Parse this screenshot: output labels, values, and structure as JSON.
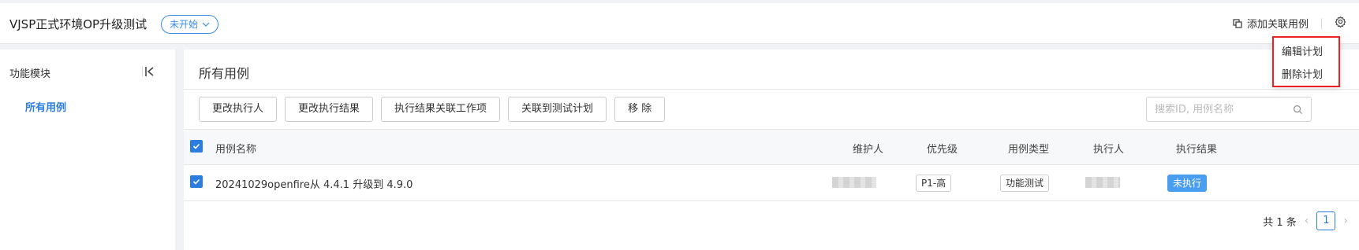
{
  "header": {
    "title": "VJSP正式环境OP升级测试",
    "status_label": "未开始",
    "add_case_label": "添加关联用例"
  },
  "dropdown": {
    "items": [
      "编辑计划",
      "删除计划"
    ]
  },
  "sidebar": {
    "title": "功能模块",
    "items": [
      {
        "label": "所有用例"
      }
    ]
  },
  "main": {
    "title": "所有用例",
    "toolbar": [
      "更改执行人",
      "更改执行结果",
      "执行结果关联工作项",
      "关联到测试计划",
      "移 除"
    ],
    "search_placeholder": "搜索ID, 用例名称",
    "table": {
      "columns": [
        "用例名称",
        "维护人",
        "优先级",
        "用例类型",
        "执行人",
        "执行结果"
      ],
      "rows": [
        {
          "name": "20241029openfire从 4.4.1 升级到 4.9.0",
          "priority": "P1-高",
          "type": "功能测试",
          "result": "未执行"
        }
      ]
    },
    "pagination": {
      "total": "共 1 条",
      "current": "1"
    }
  },
  "colors": {
    "accent": "#2b7de0",
    "highlight_border": "#ee2222",
    "result_tag": "#4a9ef0"
  }
}
